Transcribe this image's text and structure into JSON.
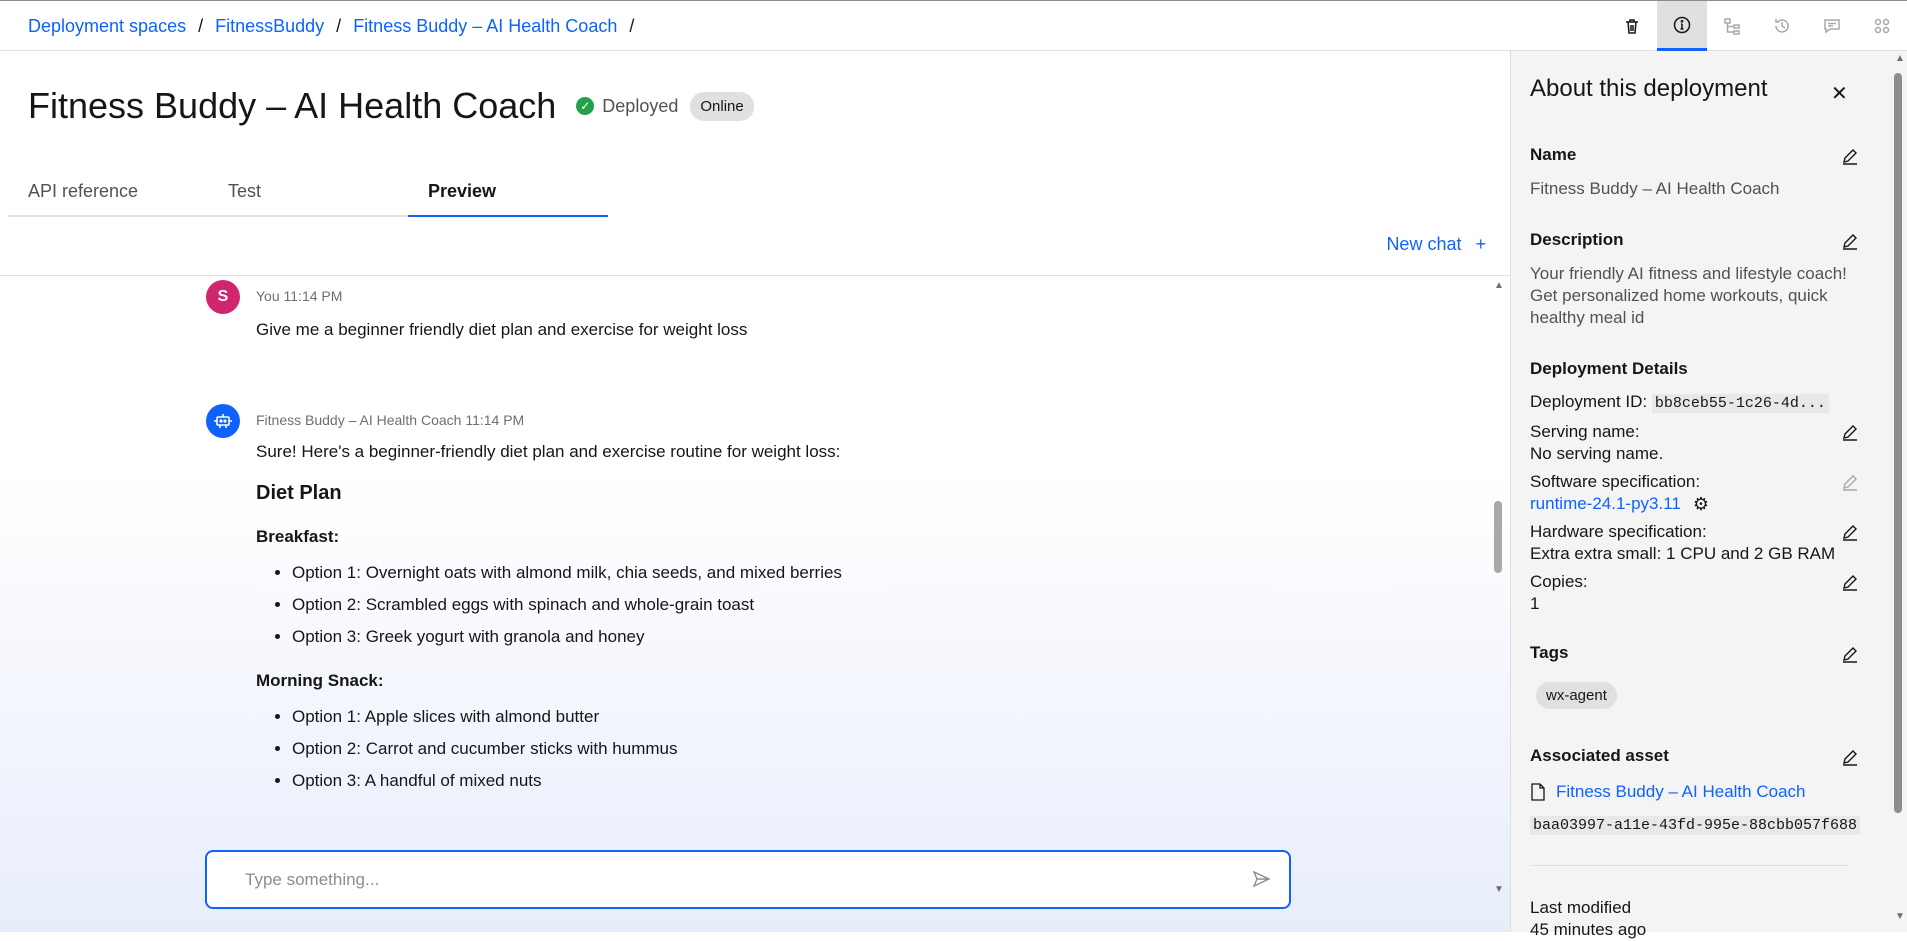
{
  "breadcrumb": {
    "items": [
      "Deployment spaces",
      "FitnessBuddy",
      "Fitness Buddy – AI Health Coach"
    ],
    "separator": "/"
  },
  "toolbar": {
    "icons": [
      "trash-icon",
      "info-icon",
      "hierarchy-icon",
      "history-icon",
      "chat-icon",
      "apps-icon"
    ]
  },
  "header": {
    "title": "Fitness Buddy – AI Health Coach",
    "status": "Deployed",
    "badge": "Online"
  },
  "tabs": [
    {
      "label": "API reference",
      "active": false
    },
    {
      "label": "Test",
      "active": false
    },
    {
      "label": "Preview",
      "active": true
    }
  ],
  "new_chat": {
    "label": "New chat",
    "icon": "+"
  },
  "chat": {
    "user_message": {
      "avatar": "S",
      "meta": "You 11:14 PM",
      "text": "Give me a beginner friendly diet plan and exercise for weight loss"
    },
    "bot_message": {
      "meta": "Fitness Buddy – AI Health Coach 11:14 PM",
      "intro": "Sure! Here's a beginner-friendly diet plan and exercise routine for weight loss:",
      "heading": "Diet Plan",
      "sections": [
        {
          "title": "Breakfast:",
          "items": [
            "Option 1: Overnight oats with almond milk, chia seeds, and mixed berries",
            "Option 2: Scrambled eggs with spinach and whole-grain toast",
            "Option 3: Greek yogurt with granola and honey"
          ]
        },
        {
          "title": "Morning Snack:",
          "items": [
            "Option 1: Apple slices with almond butter",
            "Option 2: Carrot and cucumber sticks with hummus",
            "Option 3: A handful of mixed nuts"
          ]
        }
      ]
    },
    "input_placeholder": "Type something..."
  },
  "panel": {
    "title": "About this deployment",
    "name_label": "Name",
    "name_value": "Fitness Buddy – AI Health Coach",
    "description_label": "Description",
    "description_value": "Your friendly AI fitness and lifestyle coach! Get personalized home workouts, quick healthy meal id",
    "details_label": "Deployment Details",
    "deployment_id_label": "Deployment ID:",
    "deployment_id_value": "bb8ceb55-1c26-4d...",
    "serving_name_label": "Serving name:",
    "serving_name_value": "No serving name.",
    "software_spec_label": "Software specification:",
    "software_spec_value": "runtime-24.1-py3.11",
    "hardware_spec_label": "Hardware specification:",
    "hardware_spec_value": "Extra extra small: 1 CPU and 2 GB RAM",
    "copies_label": "Copies:",
    "copies_value": "1",
    "tags_label": "Tags",
    "tags": [
      "wx-agent"
    ],
    "asset_label": "Associated asset",
    "asset_name": "Fitness Buddy – AI Health Coach",
    "asset_id": "baa03997-a11e-43fd-995e-88cbb057f688",
    "last_modified_label": "Last modified",
    "last_modified_value": "45 minutes ago"
  }
}
